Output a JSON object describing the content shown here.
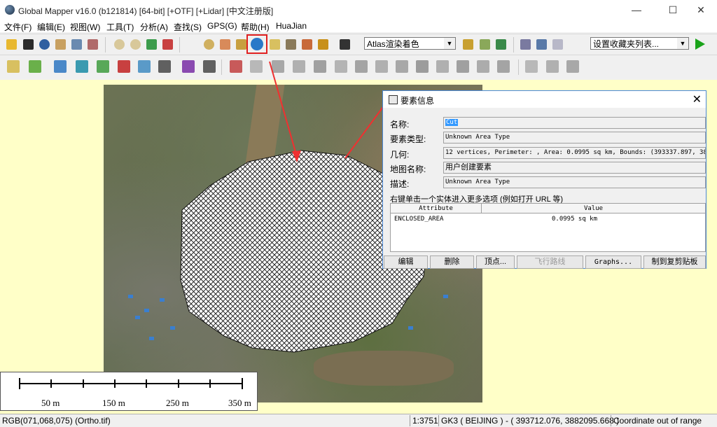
{
  "window": {
    "title": "Global Mapper v16.0 (b121814) [64-bit] [+OTF] [+Lidar] [中文注册版]",
    "min_glyph": "—",
    "max_glyph": "☐",
    "close_glyph": "✕"
  },
  "menu": [
    "文件(F)",
    "编辑(E)",
    "视图(W)",
    "工具(T)",
    "分析(A)",
    "查找(S)",
    "GPS(G)",
    "帮助(H)",
    "HuaJian"
  ],
  "toolbar": {
    "shader_combo": "Atlas渲染着色",
    "favorites_combo": "设置收藏夹列表..."
  },
  "scalebar": {
    "labels": [
      "50 m",
      "150 m",
      "250 m",
      "350 m"
    ]
  },
  "status": {
    "pixel": "RGB(071,068,075) (Ortho.tif)",
    "scale": "1:3751",
    "projection": "GK3 ( BEIJING ) - ( 393712.076, 3882095.668 )",
    "message": "Coordinate out of range"
  },
  "dialog": {
    "title": "要素信息",
    "close_glyph": "✕",
    "fields": {
      "name_label": "名称:",
      "name_value": "Cut",
      "type_label": "要素类型:",
      "type_value": "Unknown Area Type",
      "geom_label": "几何:",
      "geom_value": "12 vertices, Perimeter: , Area: 0.0995 sq km, Bounds: (393337.897, 38",
      "mapname_label": "地图名称:",
      "mapname_value": "用户创建要素",
      "desc_label": "描述:",
      "desc_value": "Unknown Area Type"
    },
    "hint": "右键单击一个实体进入更多选项 (例如打开 URL 等)",
    "table": {
      "col_attr": "Attribute",
      "col_value": "Value",
      "rows": [
        {
          "attr": "ENCLOSED_AREA",
          "value": "0.0995 sq km"
        }
      ]
    },
    "buttons": {
      "edit": "编辑",
      "delete": "删除",
      "vertices": "顶点...",
      "flight": "飞行路线",
      "graphs": "Graphs...",
      "copy": "制到复剪贴板"
    }
  }
}
